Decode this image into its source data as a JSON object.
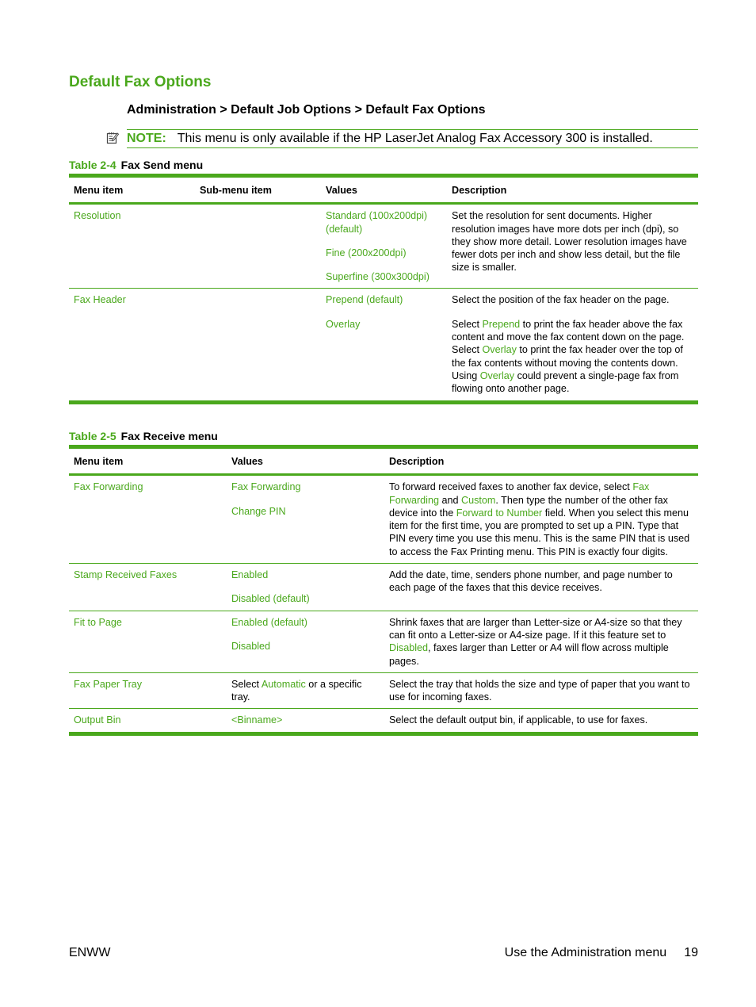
{
  "section_title": "Default Fax Options",
  "breadcrumb": "Administration > Default Job Options > Default Fax Options",
  "note": {
    "icon": "note-icon",
    "label": "NOTE:",
    "text": "This menu is only available if the HP LaserJet Analog Fax Accessory 300 is installed."
  },
  "table1": {
    "number": "Table 2-4",
    "caption": "Fax Send menu",
    "headers": [
      "Menu item",
      "Sub-menu item",
      "Values",
      "Description"
    ],
    "rows": [
      {
        "menu_item": "Resolution",
        "sub_menu_item": "",
        "values": [
          "Standard (100x200dpi) (default)",
          "Fine (200x200dpi)",
          "Superfine (300x300dpi)"
        ],
        "description": "Set the resolution for sent documents. Higher resolution images have more dots per inch (dpi), so they show more detail. Lower resolution images have fewer dots per inch and show less detail, but the file size is smaller."
      },
      {
        "menu_item": "Fax Header",
        "sub_menu_item": "",
        "values": [
          "Prepend (default)",
          "Overlay"
        ],
        "description_p1": "Select the position of the fax header on the page.",
        "description_p2": {
          "t1": "Select ",
          "l1": "Prepend",
          "t2": " to print the fax header above the fax content and move the fax content down on the page. Select ",
          "l2": "Overlay",
          "t3": " to print the fax header over the top of the fax contents without moving the contents down. Using ",
          "l3": "Overlay",
          "t4": " could prevent a single-page fax from flowing onto another page."
        }
      }
    ]
  },
  "table2": {
    "number": "Table 2-5",
    "caption": "Fax Receive menu",
    "headers": [
      "Menu item",
      "Values",
      "Description"
    ],
    "rows": [
      {
        "menu_item": "Fax Forwarding",
        "values": [
          "Fax Forwarding",
          "Change PIN"
        ],
        "description": {
          "t1": "To forward received faxes to another fax device, select ",
          "l1": "Fax Forwarding",
          "t2": " and ",
          "l2": "Custom",
          "t3": ". Then type the number of the other fax device into the ",
          "l3": "Forward to Number",
          "t4": " field. When you select this menu item for the first time, you are prompted to set up a PIN. Type that PIN every time you use this menu. This is the same PIN that is used to access the Fax Printing menu. This PIN is exactly four digits."
        }
      },
      {
        "menu_item": "Stamp Received Faxes",
        "values": [
          "Enabled",
          "Disabled (default)"
        ],
        "description": "Add the date, time, senders phone number, and page number to each page of the faxes that this device receives."
      },
      {
        "menu_item": "Fit to Page",
        "values": [
          "Enabled (default)",
          "Disabled"
        ],
        "description": {
          "t1": "Shrink faxes that are larger than Letter-size or A4-size so that they can fit onto a Letter-size or A4-size page. If it this feature set to ",
          "l1": "Disabled",
          "t2": ", faxes larger than Letter or A4 will flow across multiple pages."
        }
      },
      {
        "menu_item": "Fax Paper Tray",
        "values": {
          "t1": "Select ",
          "l1": "Automatic",
          "t2": " or a specific tray."
        },
        "description": "Select the tray that holds the size and type of paper that you want to use for incoming faxes."
      },
      {
        "menu_item": "Output Bin",
        "values": [
          "<Binname>"
        ],
        "description": "Select the default output bin, if applicable, to use for faxes."
      }
    ]
  },
  "footer": {
    "left": "ENWW",
    "section": "Use the Administration menu",
    "page": "19"
  },
  "colors": {
    "accent": "#4aa81c",
    "text": "#000000"
  }
}
